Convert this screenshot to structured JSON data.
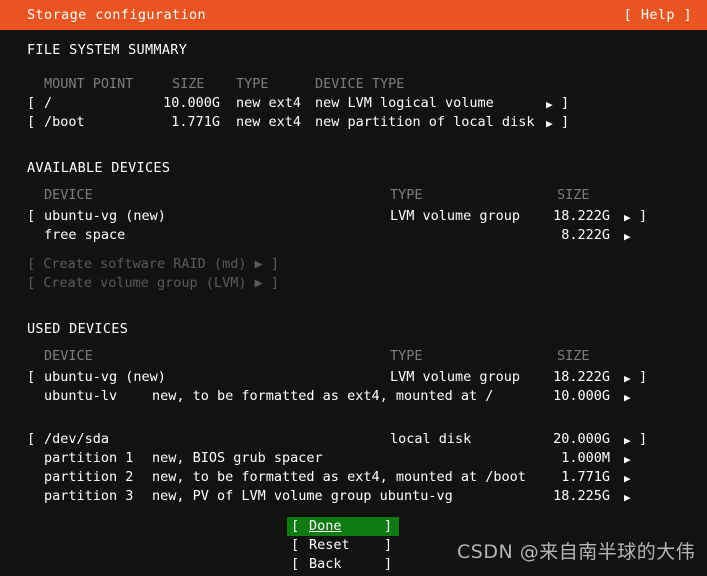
{
  "header": {
    "title": "Storage configuration",
    "help_label": "[ Help ]",
    "bar_color": "#e95420"
  },
  "sections": {
    "filesystem_summary": {
      "title": "FILE SYSTEM SUMMARY",
      "columns": [
        "MOUNT POINT",
        "SIZE",
        "TYPE",
        "DEVICE TYPE"
      ],
      "rows": [
        {
          "open_bracket": "[",
          "mount_point": "/",
          "size": "10.000G",
          "type": "new ext4",
          "device_type": "new LVM logical volume",
          "arrow": "▶",
          "close_bracket": "]"
        },
        {
          "open_bracket": "[",
          "mount_point": "/boot",
          "size": "1.771G",
          "type": "new ext4",
          "device_type": "new partition of local disk",
          "arrow": "▶",
          "close_bracket": "]"
        }
      ]
    },
    "available_devices": {
      "title": "AVAILABLE DEVICES",
      "columns": [
        "DEVICE",
        "TYPE",
        "SIZE"
      ],
      "rows": [
        {
          "open_bracket": "[",
          "device": "ubuntu-vg (new)",
          "type": "LVM volume group",
          "size": "18.222G",
          "arrow": "▶",
          "close_bracket": "]"
        },
        {
          "open_bracket": "",
          "device": "free space",
          "type": "",
          "size": "8.222G",
          "arrow": "▶",
          "close_bracket": ""
        }
      ],
      "actions": [
        {
          "label": "[ Create software RAID (md) ▶ ]",
          "disabled": true
        },
        {
          "label": "[ Create volume group (LVM) ▶ ]",
          "disabled": true
        }
      ]
    },
    "used_devices": {
      "title": "USED DEVICES",
      "columns": [
        "DEVICE",
        "TYPE",
        "SIZE"
      ],
      "groups": [
        {
          "header": {
            "open_bracket": "[",
            "device": "ubuntu-vg (new)",
            "type": "LVM volume group",
            "size": "18.222G",
            "arrow": "▶",
            "close_bracket": "]"
          },
          "children": [
            {
              "name": "ubuntu-lv",
              "description": "new, to be formatted as ext4, mounted at /",
              "size": "10.000G",
              "arrow": "▶"
            }
          ]
        },
        {
          "header": {
            "open_bracket": "[",
            "device": "/dev/sda",
            "type": "local disk",
            "size": "20.000G",
            "arrow": "▶",
            "close_bracket": "]"
          },
          "children": [
            {
              "name": "partition 1",
              "description": "new, BIOS grub spacer",
              "size": "1.000M",
              "arrow": "▶"
            },
            {
              "name": "partition 2",
              "description": "new, to be formatted as ext4, mounted at /boot",
              "size": "1.771G",
              "arrow": "▶"
            },
            {
              "name": "partition 3",
              "description": "new, PV of LVM volume group ubuntu-vg",
              "size": "18.225G",
              "arrow": "▶"
            }
          ]
        }
      ]
    }
  },
  "buttons": [
    {
      "open": "[",
      "label": "Done",
      "close": "]",
      "selected": true,
      "accel": "D"
    },
    {
      "open": "[",
      "label": "Reset",
      "close": "]",
      "selected": false,
      "accel": ""
    },
    {
      "open": "[",
      "label": "Back",
      "close": "]",
      "selected": false,
      "accel": ""
    }
  ],
  "selected_button_color": "#0e7a12",
  "watermark": "CSDN @来自南半球的大伟"
}
